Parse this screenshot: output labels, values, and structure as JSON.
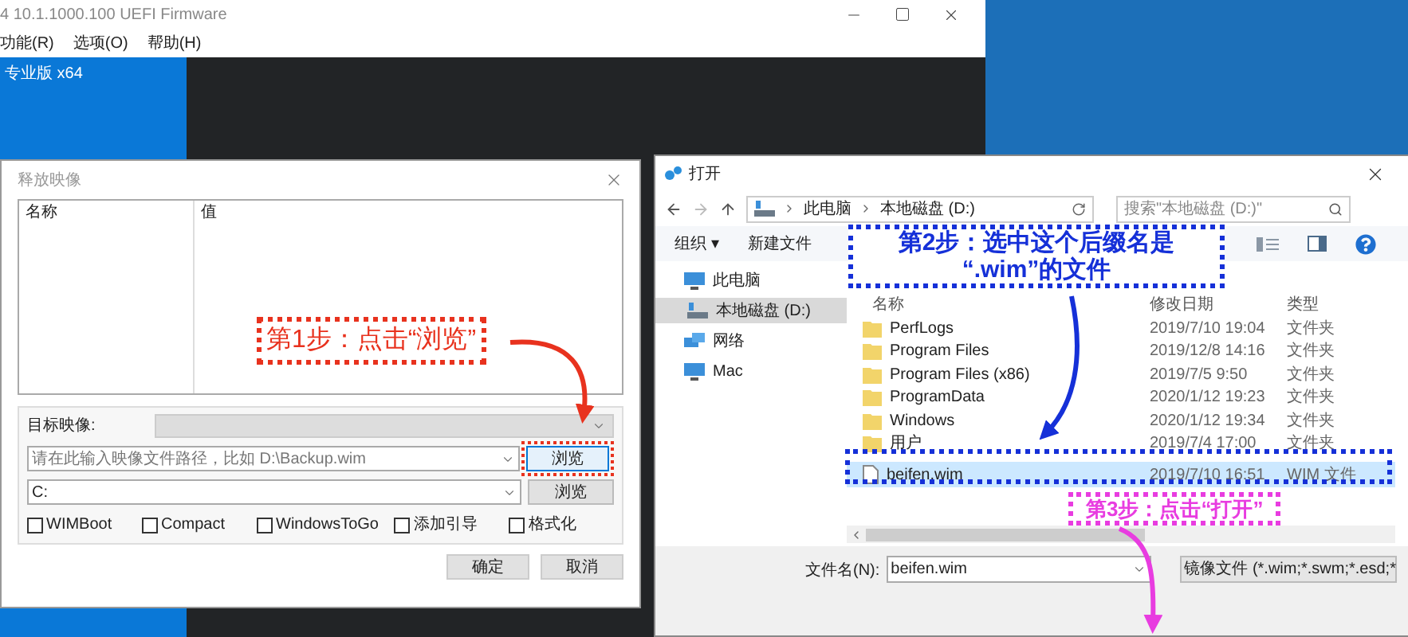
{
  "old_window": {
    "title": "4 10.1.1000.100 UEFI Firmware",
    "menu": [
      "功能(R)",
      "选项(O)",
      "帮助(H)"
    ],
    "panel_label": "专业版 x64"
  },
  "release_dialog": {
    "title": "释放映像",
    "columns": [
      "名称",
      "值"
    ],
    "target_label": "目标映像:",
    "path_placeholder": "请在此输入映像文件路径，比如 D:\\Backup.wim",
    "drive_value": "C:",
    "browse_buttons": [
      "浏览",
      "浏览"
    ],
    "checkboxes": [
      {
        "label": "WIMBoot",
        "checked": false
      },
      {
        "label": "Compact",
        "checked": false
      },
      {
        "label": "WindowsToGo",
        "checked": false
      },
      {
        "label": "添加引导",
        "checked": false
      },
      {
        "label": "格式化",
        "checked": false
      }
    ],
    "buttons": [
      "确定",
      "取消"
    ]
  },
  "open_dialog": {
    "title": "打开",
    "breadcrumb": [
      "此电脑",
      "本地磁盘 (D:)"
    ],
    "search_placeholder": "搜索\"本地磁盘 (D:)\"",
    "toolbar": [
      "组织 ▾",
      "新建文件"
    ],
    "nav": [
      {
        "label": "此电脑",
        "kind": "computer",
        "selected": false
      },
      {
        "label": "本地磁盘 (D:)",
        "kind": "drive",
        "selected": true
      },
      {
        "label": "网络",
        "kind": "network",
        "selected": false
      },
      {
        "label": "Mac",
        "kind": "computer",
        "selected": false
      }
    ],
    "columns": [
      "名称",
      "修改日期",
      "类型"
    ],
    "rows": [
      {
        "name": "PerfLogs",
        "date": "2019/7/10 19:04",
        "type": "文件夹",
        "kind": "folder",
        "selected": false
      },
      {
        "name": "Program Files",
        "date": "2019/12/8 14:16",
        "type": "文件夹",
        "kind": "folder",
        "selected": false
      },
      {
        "name": "Program Files (x86)",
        "date": "2019/7/5 9:50",
        "type": "文件夹",
        "kind": "folder",
        "selected": false
      },
      {
        "name": "ProgramData",
        "date": "2020/1/12 19:23",
        "type": "文件夹",
        "kind": "folder",
        "selected": false
      },
      {
        "name": "Windows",
        "date": "2020/1/12 19:34",
        "type": "文件夹",
        "kind": "folder",
        "selected": false
      },
      {
        "name": "用户",
        "date": "2019/7/4 17:00",
        "type": "文件夹",
        "kind": "folder",
        "selected": false
      },
      {
        "name": "beifen.wim",
        "date": "2019/7/10 16:51",
        "type": "WIM 文件",
        "kind": "file",
        "selected": true
      }
    ],
    "filename_label": "文件名(N):",
    "filename_value": "beifen.wim",
    "filetype": "镜像文件 (*.wim;*.swm;*.esd;*"
  },
  "annotations": [
    {
      "text": "第1步：点击“浏览”",
      "color": "#e8321e"
    },
    {
      "text": "第2步：选中这个后缀名是\n“.wim”的文件",
      "color": "#1530d8"
    },
    {
      "text": "第3步：点击“打开”",
      "color": "#e83ce0"
    }
  ]
}
